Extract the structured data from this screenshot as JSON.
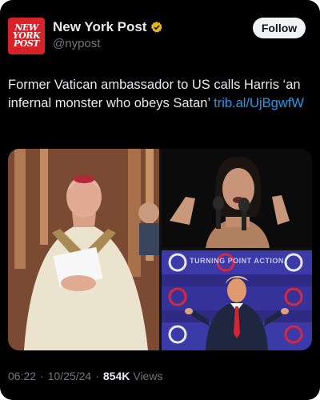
{
  "account": {
    "name": "New York Post",
    "handle": "@nypost",
    "logo_lines": [
      "NEW",
      "YORK",
      "POST"
    ],
    "verified_icon": "verified-badge-gold"
  },
  "follow_label": "Follow",
  "tweet": {
    "text": "Former Vatican ambassador to US calls Harris ‘an infernal monster who obeys Satan’ ",
    "link": "trib.al/UjBgwfW"
  },
  "media": {
    "panel_tr_banner": "TURNING POINT ACTION"
  },
  "meta": {
    "time": "06:22",
    "date": "10/25/24",
    "views_count": "854K",
    "views_label": "Views"
  },
  "colors": {
    "background": "#000000",
    "text": "#e7e9ea",
    "secondary": "#71767b",
    "link": "#1d9bf0",
    "brand_red": "#d8222a",
    "verified_gold": "#e2b719"
  }
}
